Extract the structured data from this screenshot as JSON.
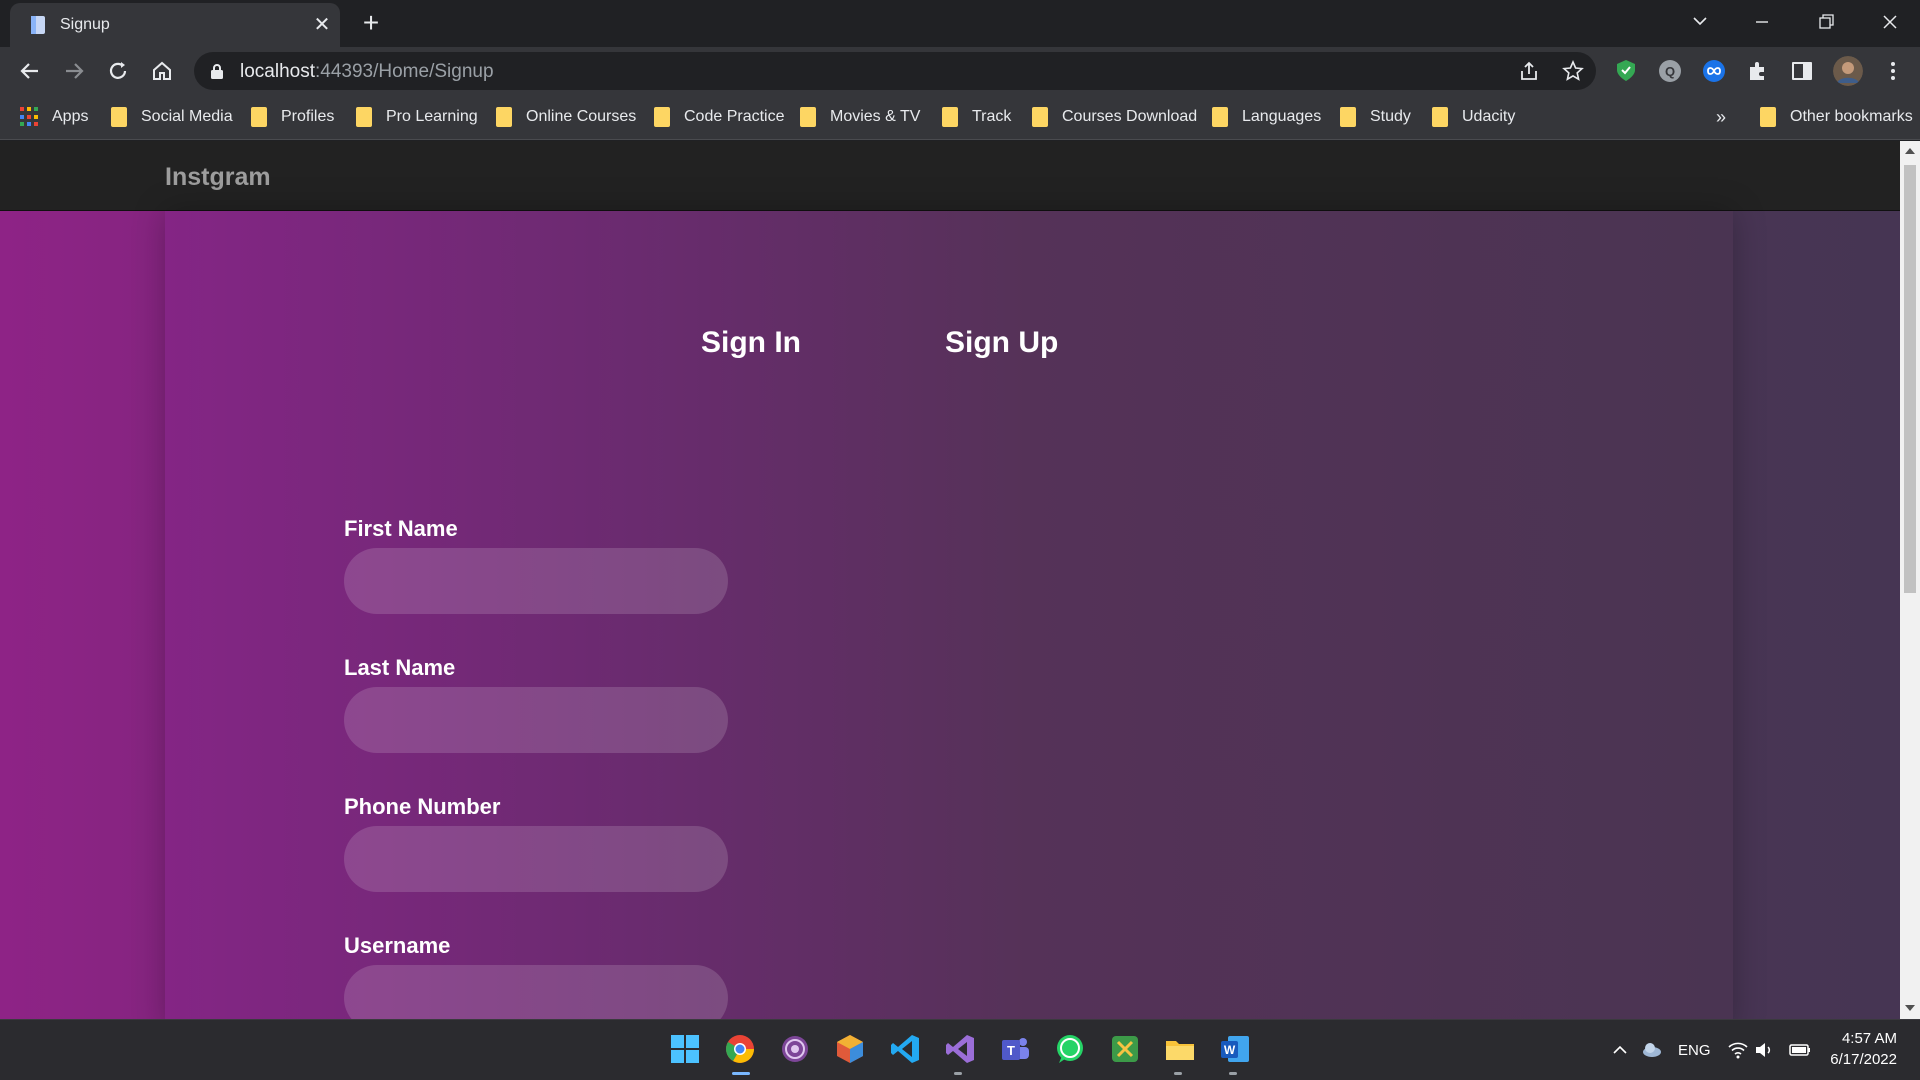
{
  "browser": {
    "tab_title": "Signup",
    "tab_close": "✕",
    "new_tab": "+",
    "url_host": "localhost",
    "url_rest": ":44393/Home/Signup",
    "bookmarks": [
      {
        "label": "Apps"
      },
      {
        "label": "Social Media"
      },
      {
        "label": "Profiles"
      },
      {
        "label": "Pro Learning"
      },
      {
        "label": "Online Courses"
      },
      {
        "label": "Code Practice"
      },
      {
        "label": "Movies & TV"
      },
      {
        "label": "Track"
      },
      {
        "label": "Courses Download"
      },
      {
        "label": "Languages"
      },
      {
        "label": "Study"
      },
      {
        "label": "Udacity"
      }
    ],
    "bookmarks_overflow": "»",
    "other_bookmarks": "Other bookmarks"
  },
  "site": {
    "brand": "Instgram",
    "tabs": {
      "sign_in": "Sign In",
      "sign_up": "Sign Up"
    },
    "fields": [
      {
        "label": "First Name",
        "value": ""
      },
      {
        "label": "Last Name",
        "value": ""
      },
      {
        "label": "Phone Number",
        "value": ""
      },
      {
        "label": "Username",
        "value": ""
      }
    ]
  },
  "taskbar": {
    "language": "ENG",
    "time": "4:57 AM",
    "date": "6/17/2022"
  },
  "colors": {
    "chrome_dark": "#202124",
    "chrome_toolbar": "#35363a",
    "navbar": "#222222",
    "brand_text": "#9d9d9d",
    "gradient_left": "#8e2386",
    "gradient_right": "#463553",
    "folder": "#fdd663"
  }
}
